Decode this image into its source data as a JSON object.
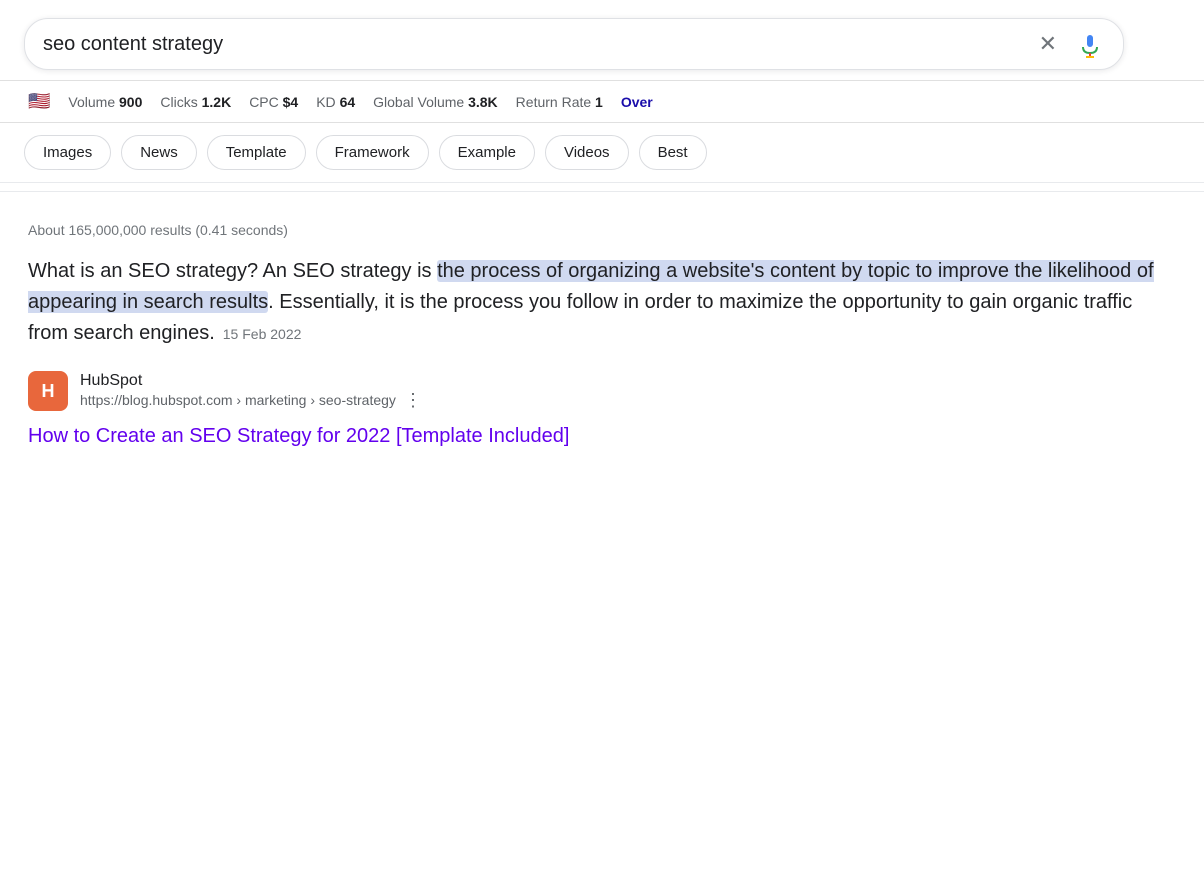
{
  "search": {
    "query": "seo content strategy",
    "clear_label": "×",
    "mic_label": "Voice search"
  },
  "stats": {
    "flag": "🇺🇸",
    "volume_label": "Volume",
    "volume_value": "900",
    "clicks_label": "Clicks",
    "clicks_value": "1.2K",
    "cpc_label": "CPC",
    "cpc_value": "$4",
    "kd_label": "KD",
    "kd_value": "64",
    "global_volume_label": "Global Volume",
    "global_volume_value": "3.8K",
    "return_rate_label": "Return Rate",
    "return_rate_value": "1",
    "overview_label": "Over"
  },
  "chips": [
    {
      "label": "Images"
    },
    {
      "label": "News"
    },
    {
      "label": "Template"
    },
    {
      "label": "Framework"
    },
    {
      "label": "Example"
    },
    {
      "label": "Videos"
    },
    {
      "label": "Best"
    }
  ],
  "results": {
    "count_text": "About 165,000,000 results (0.41 seconds)",
    "snippet": {
      "text_before": "What is an SEO strategy? An SEO strategy is ",
      "text_highlighted": "the process of organizing a website's content by topic to improve the likelihood of appearing in search results",
      "text_after": ". Essentially, it is the process you follow in order to maximize the opportunity to gain organic traffic from search engines.",
      "date": "15 Feb 2022"
    },
    "source": {
      "name": "HubSpot",
      "logo_text": "H",
      "url": "https://blog.hubspot.com › marketing › seo-strategy"
    },
    "link_text": "How to Create an SEO Strategy for 2022 [Template Included]"
  }
}
